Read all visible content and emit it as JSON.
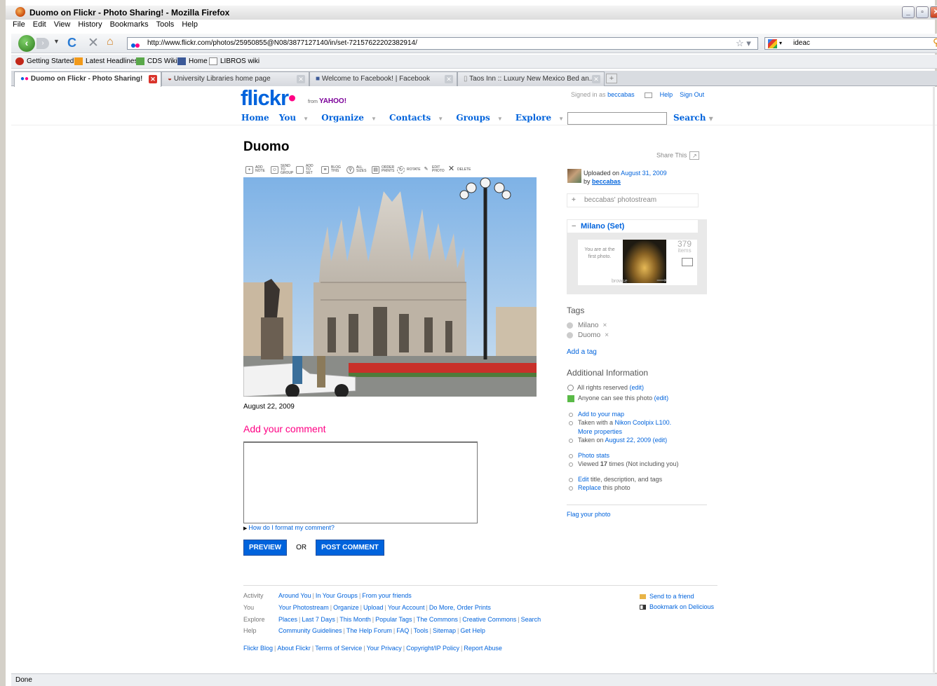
{
  "window": {
    "title": "Duomo on Flickr - Photo Sharing! - Mozilla Firefox"
  },
  "menu": [
    "File",
    "Edit",
    "View",
    "History",
    "Bookmarks",
    "Tools",
    "Help"
  ],
  "nav": {
    "url": "http://www.flickr.com/photos/25950855@N08/3877127140/in/set-72157622202382914/",
    "search_value": "ideac"
  },
  "bookmarks": [
    "Getting Started",
    "Latest Headlines",
    "CDS Wiki",
    "Home",
    "LIBROS wiki"
  ],
  "tabs": [
    "Duomo on Flickr - Photo Sharing!",
    "University Libraries home page",
    "Welcome to Facebook! | Facebook",
    "Taos Inn :: Luxury New Mexico Bed an..."
  ],
  "status": "Done",
  "flickr": {
    "logo": "flickr",
    "logo_from": "from",
    "logo_yahoo": "YAHOO!",
    "signed_in_as": "Signed in as",
    "username": "beccabas",
    "help": "Help",
    "sign_out": "Sign Out",
    "nav": [
      "Home",
      "You",
      "Organize",
      "Contacts",
      "Groups",
      "Explore"
    ],
    "search_btn": "Search"
  },
  "photo": {
    "title": "Duomo",
    "share_this": "Share This",
    "toolbar": [
      {
        "icon": "add-note-icon",
        "label": "ADD NOTE"
      },
      {
        "icon": "send-to-group-icon",
        "label": "SEND TO GROUP"
      },
      {
        "icon": "add-to-set-icon",
        "label": "ADD TO SET"
      },
      {
        "icon": "blog-this-icon",
        "label": "BLOG THIS"
      },
      {
        "icon": "all-sizes-icon",
        "label": "ALL SIZES"
      },
      {
        "icon": "order-prints-icon",
        "label": "ORDER PRINTS"
      },
      {
        "icon": "rotate-icon",
        "label": "ROTATE"
      },
      {
        "icon": "edit-photo-icon",
        "label": "EDIT PHOTO"
      },
      {
        "icon": "delete-icon",
        "label": "DELETE"
      }
    ],
    "date": "August 22, 2009",
    "add_comment": "Add your comment",
    "format_help": "How do I format my comment?",
    "preview": "PREVIEW",
    "or": "OR",
    "post": "POST COMMENT"
  },
  "sidebar": {
    "uploaded_on": "Uploaded on",
    "upload_date": "August 31, 2009",
    "by": "by",
    "uploader": "beccabas",
    "photostream": "beccabas' photostream",
    "set_title": "Milano (Set)",
    "first_photo": "You are at the first photo.",
    "items_count": "379",
    "items_label": "items",
    "browse": "browse",
    "tags_heading": "Tags",
    "tags": [
      "Milano",
      "Duomo"
    ],
    "add_tag": "Add a tag",
    "addinfo_heading": "Additional Information",
    "rights": "All rights reserved",
    "edit": "(edit)",
    "visibility": "Anyone can see this photo",
    "add_map": "Add to your map",
    "taken_with": "Taken with a",
    "camera": "Nikon Coolpix L100.",
    "more_props": "More properties",
    "taken_on": "Taken on",
    "taken_date": "August 22, 2009",
    "stats": "Photo stats",
    "viewed": "Viewed",
    "views": "17",
    "views_suffix": "times (Not including you)",
    "edit_link": "Edit",
    "edit_suffix": "title, description, and tags",
    "replace": "Replace",
    "replace_suffix": "this photo",
    "flag": "Flag your photo"
  },
  "footer": {
    "rows": [
      {
        "label": "Activity",
        "links": [
          "Around You",
          "In Your Groups",
          "From your friends"
        ]
      },
      {
        "label": "You",
        "links": [
          "Your Photostream",
          "Organize",
          "Upload",
          "Your Account",
          "Do More, Order Prints"
        ]
      },
      {
        "label": "Explore",
        "links": [
          "Places",
          "Last 7 Days",
          "This Month",
          "Popular Tags",
          "The Commons",
          "Creative Commons",
          "Search"
        ]
      },
      {
        "label": "Help",
        "links": [
          "Community Guidelines",
          "The Help Forum",
          "FAQ",
          "Tools",
          "Sitemap",
          "Get Help"
        ]
      }
    ],
    "bottom": [
      "Flickr Blog",
      "About Flickr",
      "Terms of Service",
      "Your Privacy",
      "Copyright/IP Policy",
      "Report Abuse"
    ],
    "send_friend": "Send to a friend",
    "delicious": "Bookmark on Delicious"
  },
  "colors": {
    "flickr_blue": "#0063dc",
    "flickr_pink": "#ff0084"
  }
}
